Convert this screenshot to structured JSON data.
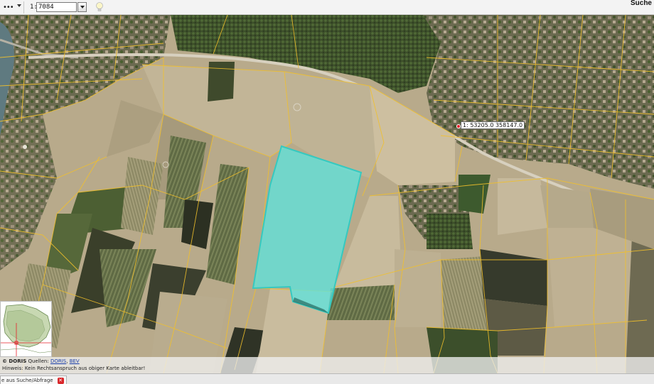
{
  "toolbar": {
    "menu_dots": "•••",
    "scale_prefix": "1:",
    "scale_value": "7084",
    "search_label": "Suche"
  },
  "map": {
    "coordinate_readout": "1: 53205.0 358147.0",
    "marker_color": "#e8202a",
    "highlight_color": "#5fe3dc",
    "parcel_line_color": "#f2c02a"
  },
  "attribution": {
    "copyright": "© DORIS",
    "sources_prefix": "Quellen:",
    "source_doris": "DORIS",
    "source_separator": ",",
    "source_bev": "BEV",
    "disclaimer": "Hinweis: Kein Rechtsanspruch aus obiger Karte ableitbar!"
  },
  "bottom_tab": {
    "label": "e aus Suche/Abfrage",
    "close_icon": "close-icon"
  }
}
